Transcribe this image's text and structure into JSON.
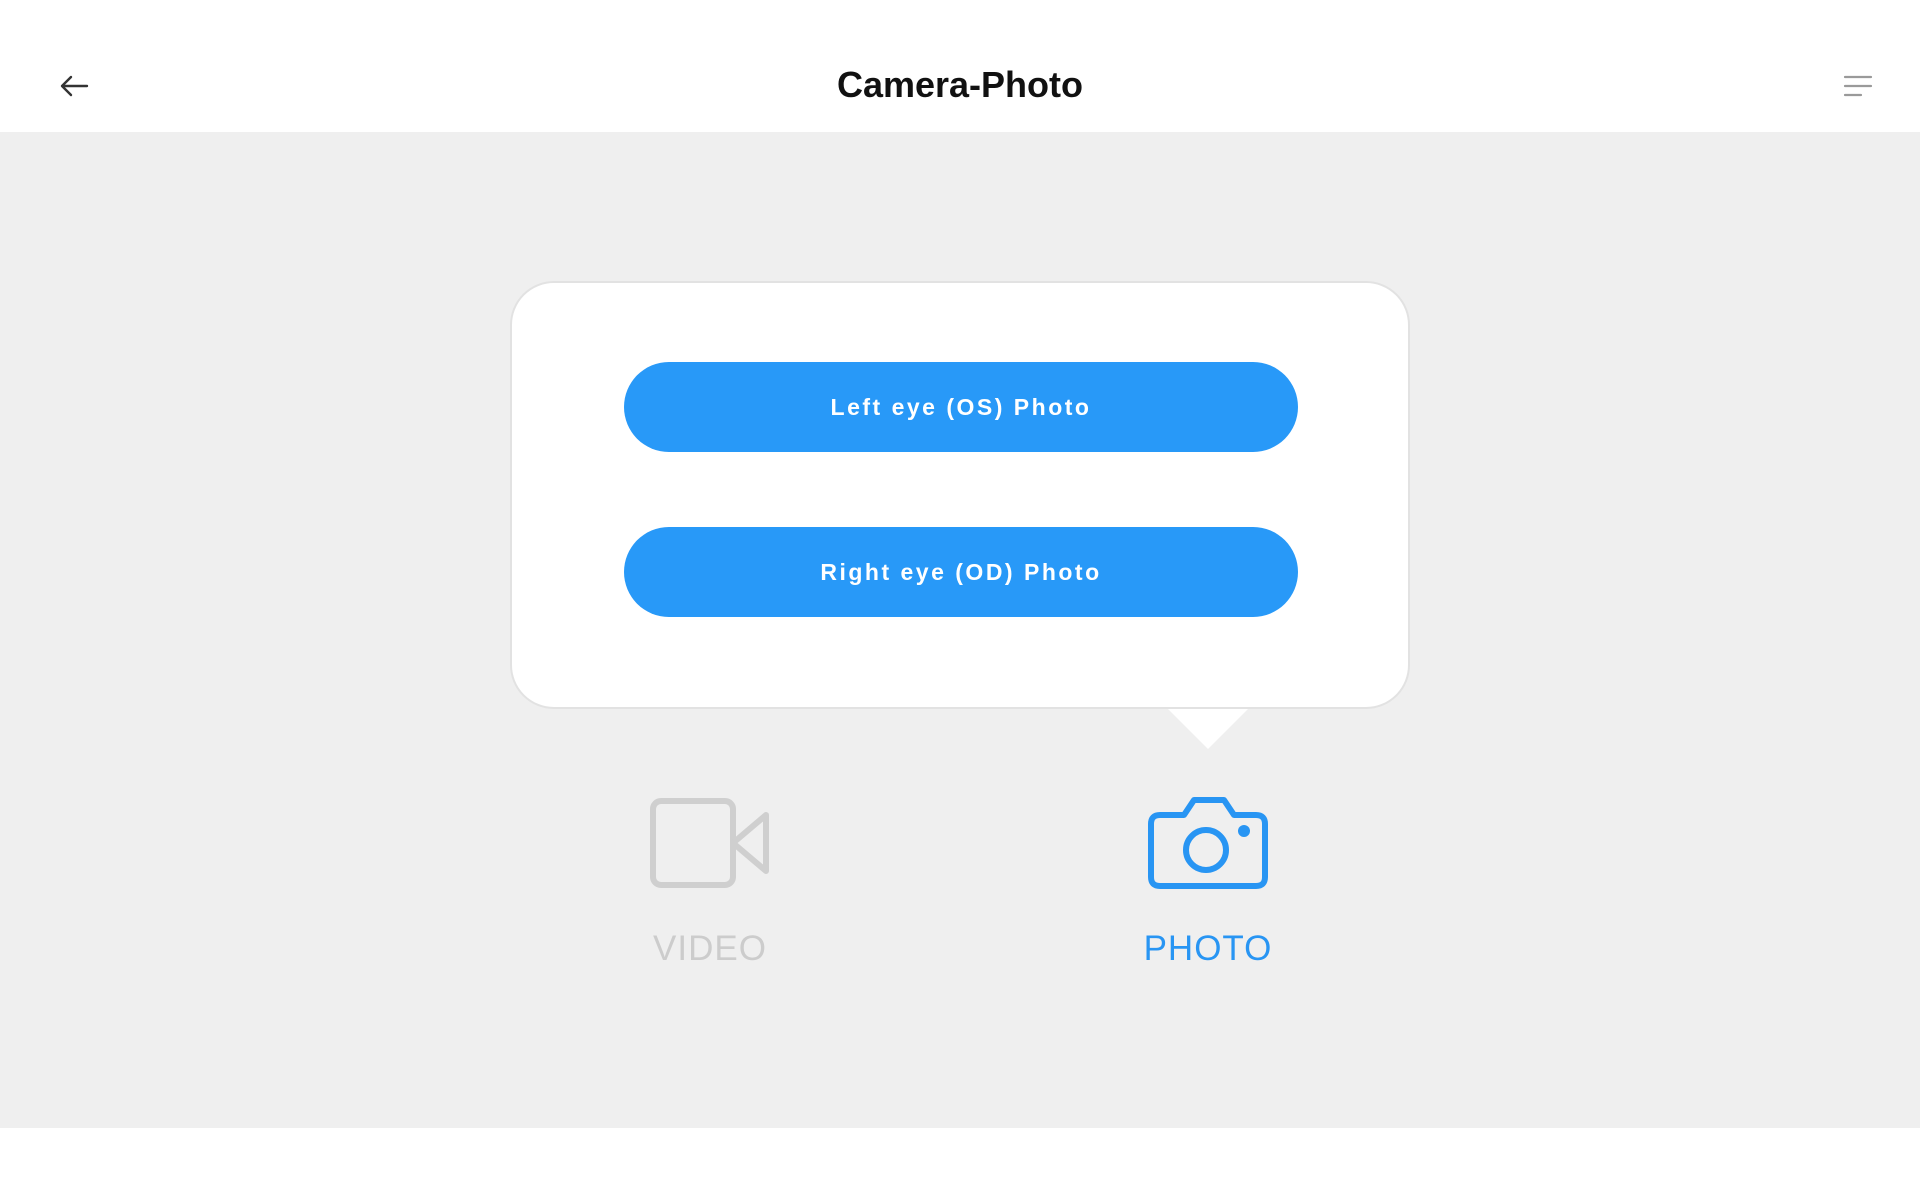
{
  "header": {
    "title": "Camera-Photo",
    "back_icon": "arrow-left-icon",
    "menu_icon": "menu-lines-icon"
  },
  "popup": {
    "left_eye_button": "Left eye (OS) Photo",
    "right_eye_button": "Right eye (OD) Photo"
  },
  "modes": {
    "video": {
      "label": "VIDEO",
      "icon": "video-camera-icon",
      "active": false
    },
    "photo": {
      "label": "PHOTO",
      "icon": "camera-icon",
      "active": true
    }
  },
  "colors": {
    "accent": "#2899f8",
    "inactive": "#cccccc",
    "background": "#efefef"
  }
}
